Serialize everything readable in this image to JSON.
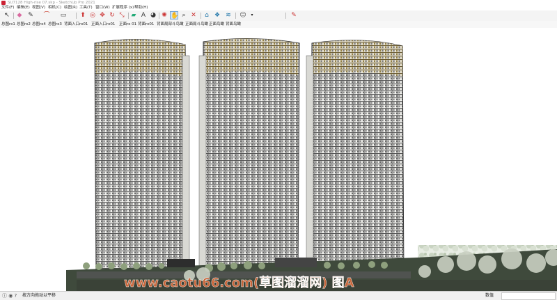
{
  "window": {
    "title": "SU7128 High-rise 07.skp - SketchUp Pro 2021"
  },
  "menu": [
    "文件(F)",
    "编辑(E)",
    "视图(V)",
    "相机(C)",
    "绘图(R)",
    "工具(T)",
    "窗口(W)",
    "扩展程序 (x)",
    "帮助(H)"
  ],
  "toolbar": {
    "tools": [
      {
        "name": "select-icon",
        "glyph": "↖",
        "color": "#222"
      },
      {
        "name": "eraser-icon",
        "glyph": "◆",
        "color": "#d96aa0"
      },
      {
        "name": "pencil-icon",
        "glyph": "✎",
        "color": "#333"
      },
      {
        "name": "arc-icon",
        "glyph": "⌒",
        "color": "#c43"
      },
      {
        "name": "rectangle-icon",
        "glyph": "▭",
        "color": "#444"
      },
      {
        "name": "push-pull-icon",
        "glyph": "⬆",
        "color": "#c33"
      },
      {
        "name": "offset-icon",
        "glyph": "◎",
        "color": "#c33"
      },
      {
        "name": "move-icon",
        "glyph": "✥",
        "color": "#c33"
      },
      {
        "name": "rotate-icon",
        "glyph": "↻",
        "color": "#c33"
      },
      {
        "name": "scale-icon",
        "glyph": "⤡",
        "color": "#c33"
      },
      {
        "name": "tape-measure-icon",
        "glyph": "▰",
        "color": "#2a7"
      },
      {
        "name": "text-icon",
        "glyph": "A",
        "color": "#333"
      },
      {
        "name": "paint-bucket-icon",
        "glyph": "◕",
        "color": "#333"
      },
      {
        "name": "orbit-icon",
        "glyph": "✺",
        "color": "#c33"
      },
      {
        "name": "pan-icon",
        "glyph": "✋",
        "color": "#c33"
      },
      {
        "name": "zoom-icon",
        "glyph": "⌕",
        "color": "#333"
      },
      {
        "name": "zoom-extents-icon",
        "glyph": "✕",
        "color": "#c33"
      },
      {
        "name": "warehouse-icon",
        "glyph": "⌂",
        "color": "#27a"
      },
      {
        "name": "extension-warehouse-icon",
        "glyph": "❖",
        "color": "#27a"
      },
      {
        "name": "send-to-layout-icon",
        "glyph": "≋",
        "color": "#27a"
      },
      {
        "name": "account-icon",
        "glyph": "☺",
        "color": "#555"
      },
      {
        "name": "edit-icon",
        "glyph": "✎",
        "color": "#c33"
      }
    ]
  },
  "scenes": [
    "总图rx1",
    "总图rx2",
    "总图rx4",
    "总图rx3",
    "背面入口rx01",
    "正面入口rx01",
    "正面rx 01",
    "背面rx01",
    "背面局部斗鸟瞰",
    "正面局斗鸟瞰",
    "正面鸟瞰",
    "背面鸟瞰"
  ],
  "status": {
    "hint": "按方向拖动以平移",
    "vcb_label": "数值",
    "vcb_value": ""
  },
  "watermark": {
    "text": "www.caotu66.com(草图溜溜网) 图A"
  }
}
